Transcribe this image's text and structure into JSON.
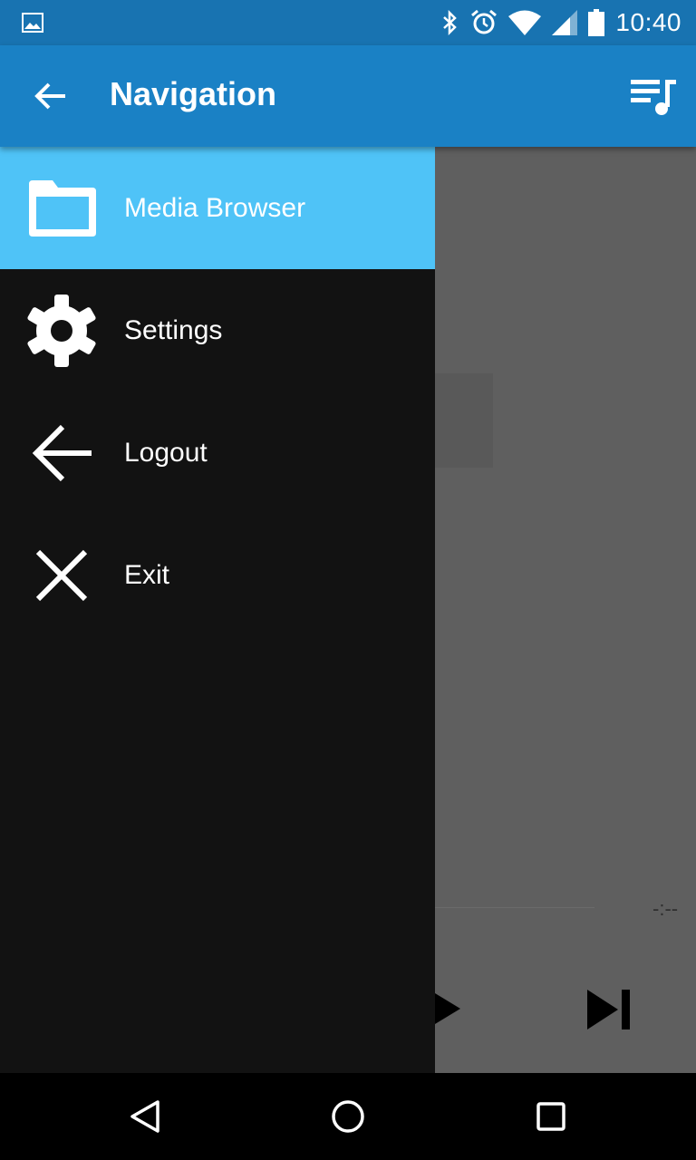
{
  "status_bar": {
    "time": "10:40",
    "icons": [
      "image-notification-icon",
      "bluetooth-icon",
      "alarm-icon",
      "wifi-icon",
      "cell-signal-icon",
      "battery-icon"
    ]
  },
  "app_bar": {
    "title": "Navigation",
    "back_icon": "arrow-back-icon",
    "action_icon": "queue-music-icon"
  },
  "drawer": {
    "items": [
      {
        "label": "Media Browser",
        "icon": "folder-icon",
        "active": true
      },
      {
        "label": "Settings",
        "icon": "gear-icon",
        "active": false
      },
      {
        "label": "Logout",
        "icon": "arrow-left-icon",
        "active": false
      },
      {
        "label": "Exit",
        "icon": "close-icon",
        "active": false
      }
    ]
  },
  "background": {
    "time_placeholder": "-:--"
  },
  "colors": {
    "status_bar": "#1873b1",
    "app_bar": "#1a81c5",
    "drawer": "#121212",
    "active_item": "#4fc3f7",
    "scrim": "#5f5f5f"
  },
  "nav_bar": {
    "buttons": [
      "back-triangle-icon",
      "home-circle-icon",
      "recents-square-icon"
    ]
  }
}
